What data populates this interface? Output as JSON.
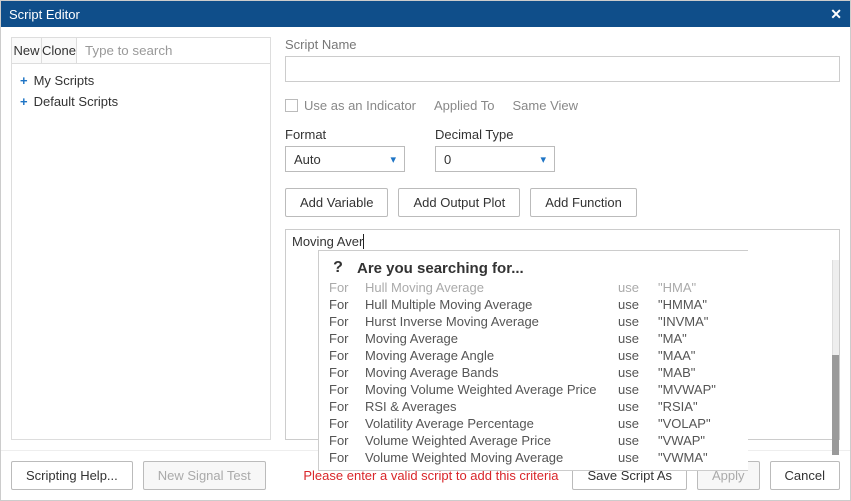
{
  "titlebar": {
    "title": "Script Editor"
  },
  "left": {
    "new_btn": "New",
    "clone_btn": "Clone",
    "search_placeholder": "Type to search",
    "tree": [
      {
        "label": "My Scripts"
      },
      {
        "label": "Default Scripts"
      }
    ]
  },
  "right": {
    "script_name_label": "Script Name",
    "script_name_value": "",
    "use_as_indicator_label": "Use as an Indicator",
    "applied_to_label": "Applied To",
    "same_view_label": "Same View",
    "format_label": "Format",
    "decimal_type_label": "Decimal Type",
    "format_value": "Auto",
    "decimal_value": "0",
    "add_variable": "Add Variable",
    "add_output_plot": "Add Output Plot",
    "add_function": "Add Function",
    "editor_text": "Moving Aver",
    "suggest": {
      "title": "Are you searching for...",
      "rows": [
        {
          "c1": "For",
          "c2": "Hull Moving Average",
          "c3": "use",
          "c4": "\"HMA\"",
          "muted": true
        },
        {
          "c1": "For",
          "c2": "Hull Multiple Moving Average",
          "c3": "use",
          "c4": "\"HMMA\""
        },
        {
          "c1": "For",
          "c2": "Hurst Inverse Moving Average",
          "c3": "use",
          "c4": "\"INVMA\""
        },
        {
          "c1": "For",
          "c2": "Moving Average",
          "c3": "use",
          "c4": "\"MA\""
        },
        {
          "c1": "For",
          "c2": "Moving Average Angle",
          "c3": "use",
          "c4": "\"MAA\""
        },
        {
          "c1": "For",
          "c2": "Moving Average Bands",
          "c3": "use",
          "c4": "\"MAB\""
        },
        {
          "c1": "For",
          "c2": "Moving Volume Weighted Average Price",
          "c3": "use",
          "c4": "\"MVWAP\""
        },
        {
          "c1": "For",
          "c2": "RSI & Averages",
          "c3": "use",
          "c4": "\"RSIA\""
        },
        {
          "c1": "For",
          "c2": "Volatility Average Percentage",
          "c3": "use",
          "c4": "\"VOLAP\""
        },
        {
          "c1": "For",
          "c2": "Volume Weighted Average Price",
          "c3": "use",
          "c4": "\"VWAP\""
        },
        {
          "c1": "For",
          "c2": "Volume Weighted Moving Average",
          "c3": "use",
          "c4": "\"VWMA\""
        }
      ]
    }
  },
  "footer": {
    "scripting_help": "Scripting Help...",
    "new_signal_test": "New Signal Test",
    "error_msg": "Please enter a valid script to add this criteria",
    "save_as": "Save Script As",
    "apply": "Apply",
    "cancel": "Cancel"
  }
}
